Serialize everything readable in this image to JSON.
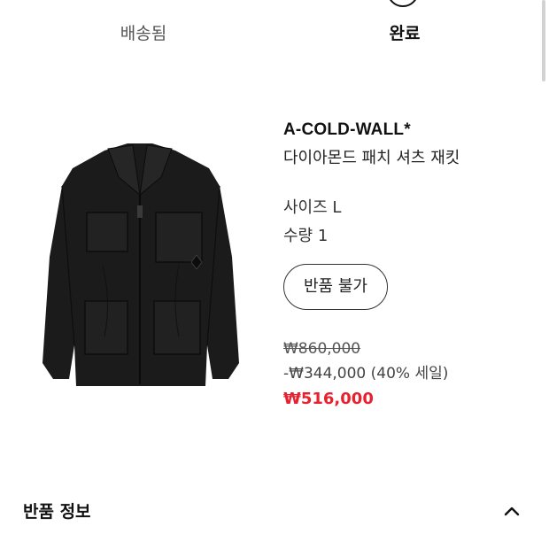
{
  "steps": {
    "shipped_label": "배송됨",
    "done_label": "완료"
  },
  "product": {
    "brand": "A-COLD-WALL*",
    "name": "다이아몬드 패치 셔츠 재킷",
    "size": "사이즈 L",
    "quantity": "수량 1",
    "return_button": "반품 불가",
    "price_original": "₩860,000",
    "price_discount": "-₩344,000 (40% 세일)",
    "price_final": "₩516,000"
  },
  "return_section": {
    "title": "반품 정보",
    "icon": "chevron-up-icon"
  },
  "colors": {
    "accent_red": "#e8212f",
    "text_dark": "#111111"
  }
}
